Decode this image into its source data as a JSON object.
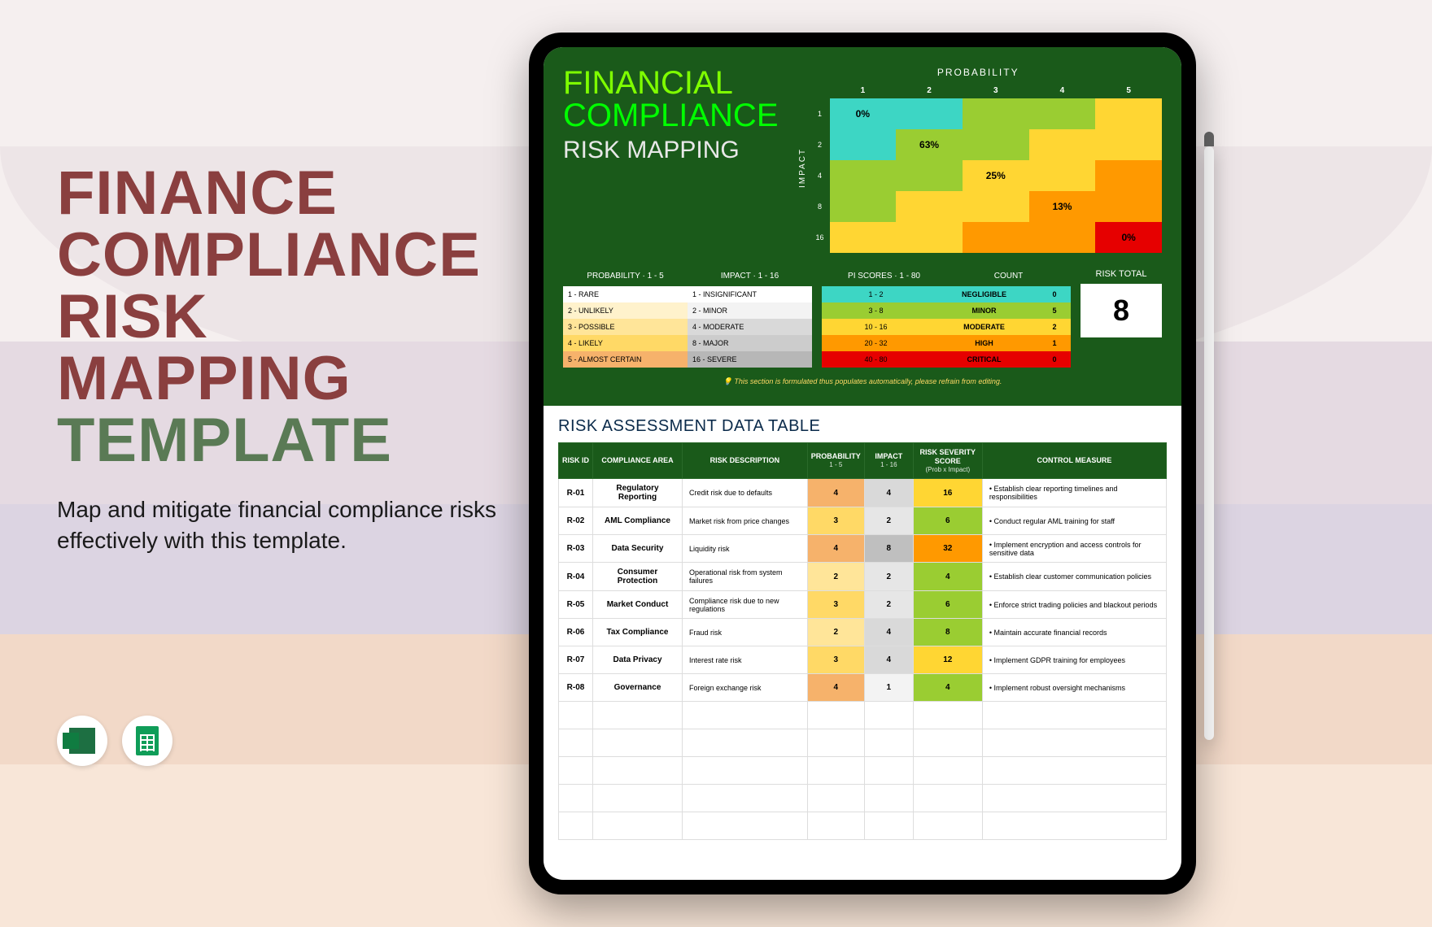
{
  "promo": {
    "title_line1": "FINANCE",
    "title_line2": "COMPLIANCE",
    "title_line3": "RISK",
    "title_line4": "MAPPING",
    "title_line5": "TEMPLATE",
    "subtitle": "Map and mitigate financial compliance risks effectively with this template."
  },
  "panel_title": {
    "l1": "FINANCIAL",
    "l2": "COMPLIANCE",
    "l3": "RISK MAPPING"
  },
  "matrix": {
    "prob_label": "PROBABILITY",
    "impact_label": "IMPACT",
    "prob_headers": [
      "1",
      "2",
      "3",
      "4",
      "5"
    ],
    "impact_labels": [
      "1",
      "2",
      "4",
      "8",
      "16"
    ],
    "percents": [
      "0%",
      "63%",
      "25%",
      "13%",
      "0%"
    ]
  },
  "legend": {
    "prob_header": "PROBABILITY · 1 - 5",
    "impact_header": "IMPACT · 1 - 16",
    "prob_rows": [
      "1 - RARE",
      "2 - UNLIKELY",
      "3 - POSSIBLE",
      "4 - LIKELY",
      "5 - ALMOST CERTAIN"
    ],
    "impact_rows": [
      "1 - INSIGNIFICANT",
      "2 - MINOR",
      "4 - MODERATE",
      "8 - MAJOR",
      "16 - SEVERE"
    ],
    "pi_header": "PI SCORES · 1 - 80",
    "count_header": "COUNT",
    "pi_rows": [
      {
        "range": "1 - 2",
        "label": "NEGLIGIBLE",
        "count": "0"
      },
      {
        "range": "3 - 8",
        "label": "MINOR",
        "count": "5"
      },
      {
        "range": "10 - 16",
        "label": "MODERATE",
        "count": "2"
      },
      {
        "range": "20 - 32",
        "label": "HIGH",
        "count": "1"
      },
      {
        "range": "40 - 80",
        "label": "CRITICAL",
        "count": "0"
      }
    ],
    "risk_total_label": "RISK TOTAL",
    "risk_total": "8",
    "note": "💡 This section is formulated thus populates automatically, please refrain from editing."
  },
  "table": {
    "title": "RISK ASSESSMENT DATA TABLE",
    "headers": {
      "id": "RISK ID",
      "area": "COMPLIANCE AREA",
      "desc": "RISK DESCRIPTION",
      "prob": "PROBABILITY",
      "prob_sub": "1 - 5",
      "impact": "IMPACT",
      "impact_sub": "1 - 16",
      "score": "RISK SEVERITY SCORE",
      "score_sub": "(Prob x Impact)",
      "control": "CONTROL MEASURE"
    },
    "rows": [
      {
        "id": "R-01",
        "area": "Regulatory Reporting",
        "desc": "Credit risk due to defaults",
        "prob": "4",
        "impact": "4",
        "score": "16",
        "control": "• Establish clear reporting timelines and responsibilities"
      },
      {
        "id": "R-02",
        "area": "AML Compliance",
        "desc": "Market risk from price changes",
        "prob": "3",
        "impact": "2",
        "score": "6",
        "control": "• Conduct regular AML training for staff"
      },
      {
        "id": "R-03",
        "area": "Data Security",
        "desc": "Liquidity risk",
        "prob": "4",
        "impact": "8",
        "score": "32",
        "control": "• Implement encryption and access controls for sensitive data"
      },
      {
        "id": "R-04",
        "area": "Consumer Protection",
        "desc": "Operational risk from system failures",
        "prob": "2",
        "impact": "2",
        "score": "4",
        "control": "• Establish clear customer communication policies"
      },
      {
        "id": "R-05",
        "area": "Market Conduct",
        "desc": "Compliance risk due to new regulations",
        "prob": "3",
        "impact": "2",
        "score": "6",
        "control": "• Enforce strict trading policies and blackout periods"
      },
      {
        "id": "R-06",
        "area": "Tax Compliance",
        "desc": "Fraud risk",
        "prob": "2",
        "impact": "4",
        "score": "8",
        "control": "• Maintain accurate financial records"
      },
      {
        "id": "R-07",
        "area": "Data Privacy",
        "desc": "Interest rate risk",
        "prob": "3",
        "impact": "4",
        "score": "12",
        "control": "• Implement GDPR training for employees"
      },
      {
        "id": "R-08",
        "area": "Governance",
        "desc": "Foreign exchange risk",
        "prob": "4",
        "impact": "1",
        "score": "4",
        "control": "• Implement robust oversight mechanisms"
      }
    ]
  },
  "colors": {
    "neg": "#3dd6c4",
    "minor": "#9acd32",
    "mod": "#ffd633",
    "high": "#ff9900",
    "crit": "#e60000",
    "p1": "#ffffff",
    "p2": "#fff2cc",
    "p3": "#ffe599",
    "p4": "#ffd966",
    "p5": "#f6b26b",
    "i1": "#ffffff",
    "i2": "#f3f3f3",
    "i3": "#d9d9d9",
    "i4": "#cccccc",
    "i5": "#b7b7b7"
  },
  "chart_data": {
    "type": "heatmap",
    "title": "Financial Compliance Risk Mapping – Probability × Impact Matrix",
    "xlabel": "PROBABILITY",
    "ylabel": "IMPACT",
    "x_categories": [
      1,
      2,
      3,
      4,
      5
    ],
    "y_categories": [
      1,
      2,
      4,
      8,
      16
    ],
    "diagonal_percents": {
      "1x1": 0,
      "2x2": 63,
      "3x4": 25,
      "4x8": 13,
      "5x16": 0
    },
    "legend_bands": [
      {
        "range": "1-2",
        "label": "NEGLIGIBLE",
        "color": "#3dd6c4",
        "count": 0
      },
      {
        "range": "3-8",
        "label": "MINOR",
        "color": "#9acd32",
        "count": 5
      },
      {
        "range": "10-16",
        "label": "MODERATE",
        "color": "#ffd633",
        "count": 2
      },
      {
        "range": "20-32",
        "label": "HIGH",
        "color": "#ff9900",
        "count": 1
      },
      {
        "range": "40-80",
        "label": "CRITICAL",
        "color": "#e60000",
        "count": 0
      }
    ],
    "risk_total": 8
  }
}
